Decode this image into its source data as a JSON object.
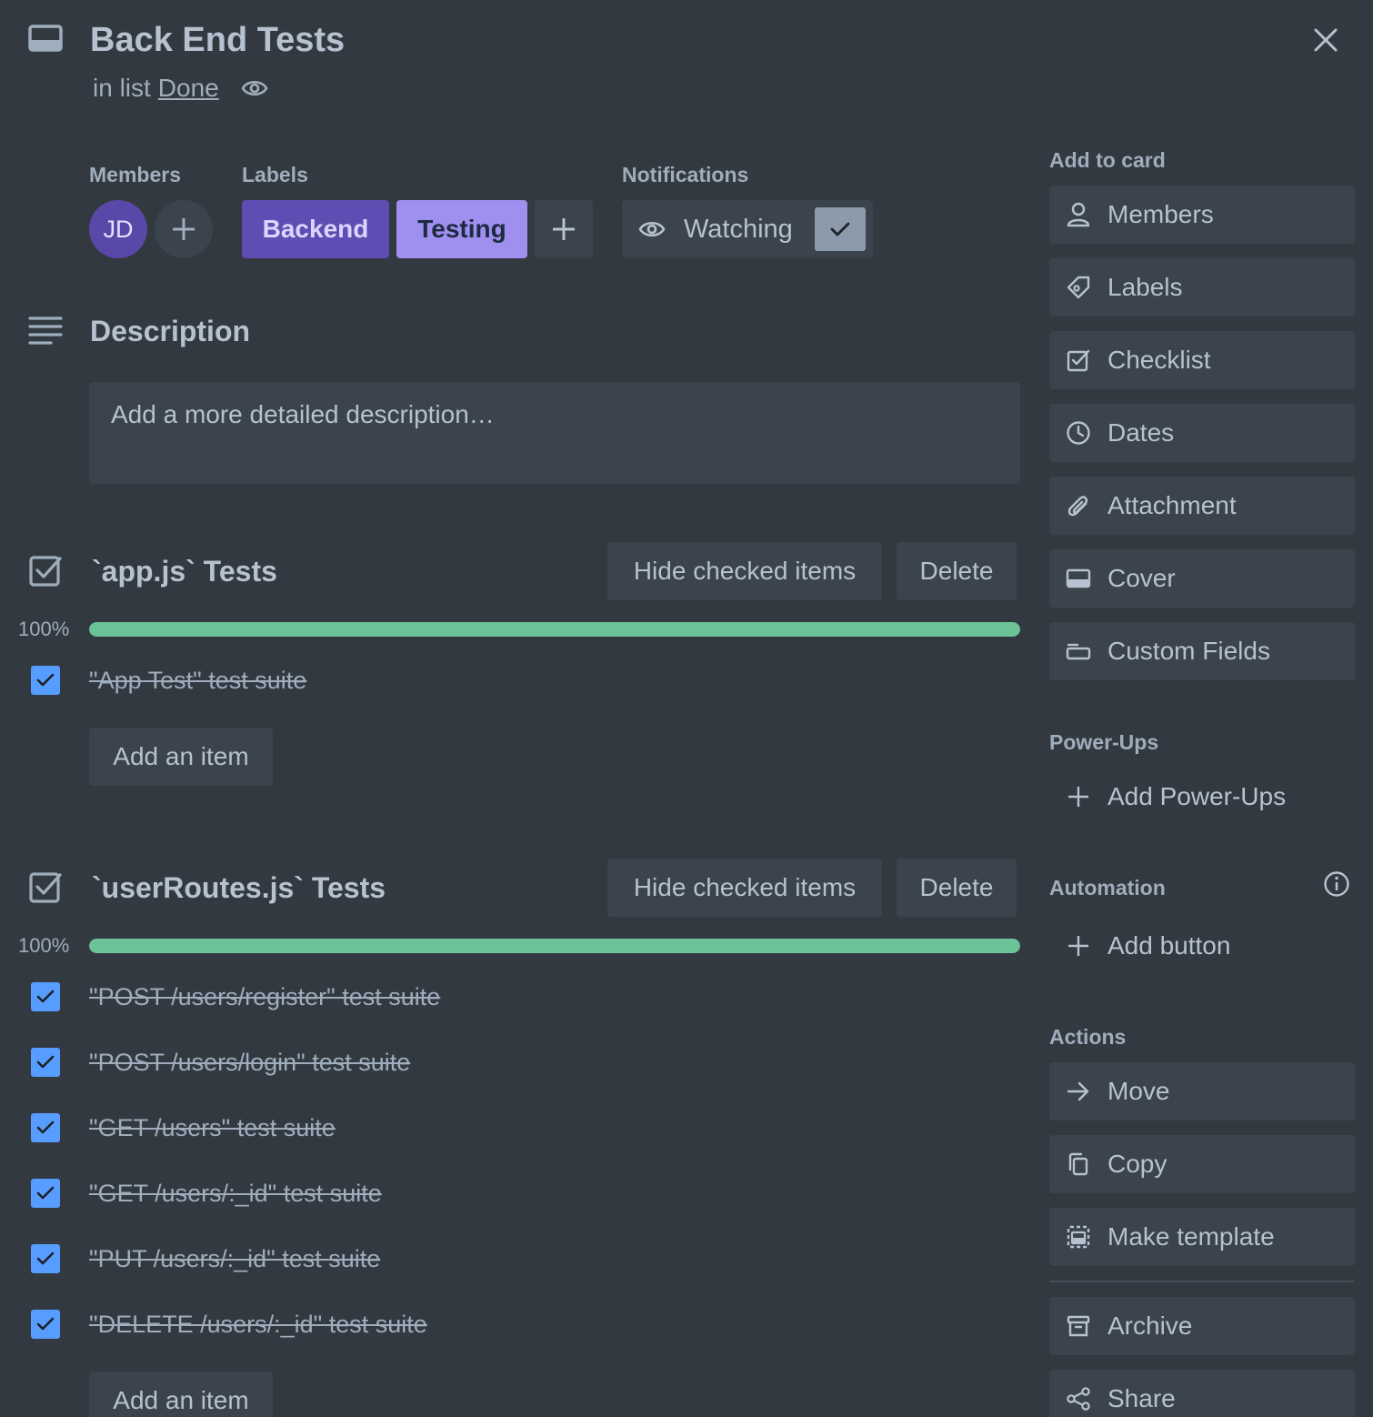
{
  "card": {
    "title": "Back End Tests",
    "list_prefix": "in list",
    "list_name": "Done"
  },
  "members": {
    "label": "Members",
    "avatar_initials": "JD"
  },
  "labels": {
    "label": "Labels",
    "items": [
      {
        "name": "Backend",
        "color": "#5e4db2"
      },
      {
        "name": "Testing",
        "color": "#9f8fef"
      }
    ]
  },
  "notifications": {
    "label": "Notifications",
    "watch_label": "Watching"
  },
  "description": {
    "title": "Description",
    "placeholder": "Add a more detailed description…"
  },
  "checklists": [
    {
      "title": "`app.js` Tests",
      "progress_label": "100%",
      "progress": 1.0,
      "hide_label": "Hide checked items",
      "delete_label": "Delete",
      "add_label": "Add an item",
      "items": [
        "\"App Test\" test suite"
      ]
    },
    {
      "title": "`userRoutes.js` Tests",
      "progress_label": "100%",
      "progress": 1.0,
      "hide_label": "Hide checked items",
      "delete_label": "Delete",
      "add_label": "Add an item",
      "items": [
        "\"POST /users/register\" test suite",
        "\"POST /users/login\" test suite",
        "\"GET /users\" test suite",
        "\"GET /users/:_id\" test suite",
        "\"PUT /users/:_id\" test suite",
        "\"DELETE /users/:_id\" test suite"
      ]
    }
  ],
  "sidebar": {
    "add_to_card": {
      "label": "Add to card",
      "items": [
        {
          "label": "Members",
          "icon": "person-icon"
        },
        {
          "label": "Labels",
          "icon": "tag-icon"
        },
        {
          "label": "Checklist",
          "icon": "checklist-icon"
        },
        {
          "label": "Dates",
          "icon": "clock-icon"
        },
        {
          "label": "Attachment",
          "icon": "paperclip-icon"
        },
        {
          "label": "Cover",
          "icon": "cover-icon"
        },
        {
          "label": "Custom Fields",
          "icon": "custom-fields-icon"
        }
      ]
    },
    "power_ups": {
      "label": "Power-Ups",
      "add_label": "Add Power-Ups"
    },
    "automation": {
      "label": "Automation",
      "add_label": "Add button"
    },
    "actions": {
      "label": "Actions",
      "items": [
        {
          "label": "Move",
          "icon": "arrow-right-icon"
        },
        {
          "label": "Copy",
          "icon": "copy-icon"
        },
        {
          "label": "Make template",
          "icon": "template-icon"
        },
        {
          "label": "Archive",
          "icon": "archive-icon"
        },
        {
          "label": "Share",
          "icon": "share-icon"
        }
      ]
    }
  },
  "colors": {
    "background": "#323940",
    "button": "#3b434c",
    "progress": "#6cc398",
    "checkbox": "#579dff"
  }
}
